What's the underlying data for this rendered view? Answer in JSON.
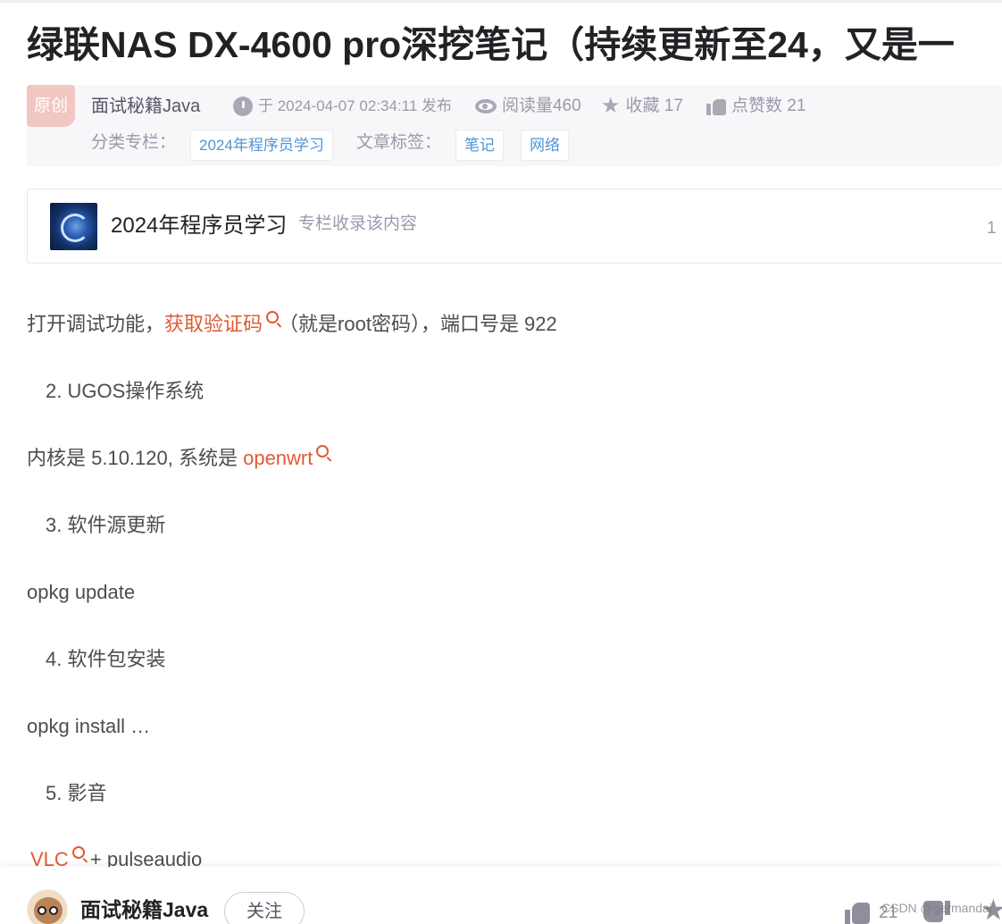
{
  "article": {
    "title": "绿联NAS DX-4600 pro深挖笔记（持续更新至24，又是一",
    "original_badge": "原创",
    "author": "面试秘籍Java",
    "date": "于 2024-04-07 02:34:11 发布",
    "views": "阅读量460",
    "favorites": "收藏 17",
    "likes": "点赞数 21",
    "category_label": "分类专栏：",
    "category": "2024年程序员学习",
    "tags_label": "文章标签：",
    "tags": [
      "笔记",
      "网络"
    ]
  },
  "column": {
    "name": "2024年程序员学习",
    "desc": "专栏收录该内容",
    "count": "1"
  },
  "content": {
    "p1_before": "打开调试功能，",
    "p1_link": "获取验证码",
    "p1_after": "（就是root密码），端口号是 922",
    "h2": "2. UGOS操作系统",
    "p2_before": "内核是 5.10.120, 系统是 ",
    "p2_link": "openwrt",
    "h3": "3. 软件源更新",
    "p3": "opkg update",
    "h4": "4. 软件包安装",
    "p4": "opkg install …",
    "h5": "5. 影音",
    "p5_link": "VLC",
    "p5_after": " + pulseaudio"
  },
  "bottom_bar": {
    "author": "面试秘籍Java",
    "follow": "关注",
    "like_count": "21",
    "watermark": "CSDN @germandai"
  },
  "colors": {
    "keyword_link": "#e05a35",
    "tag_text": "#5094d5",
    "original_badge_bg": "#f1c7c1"
  }
}
